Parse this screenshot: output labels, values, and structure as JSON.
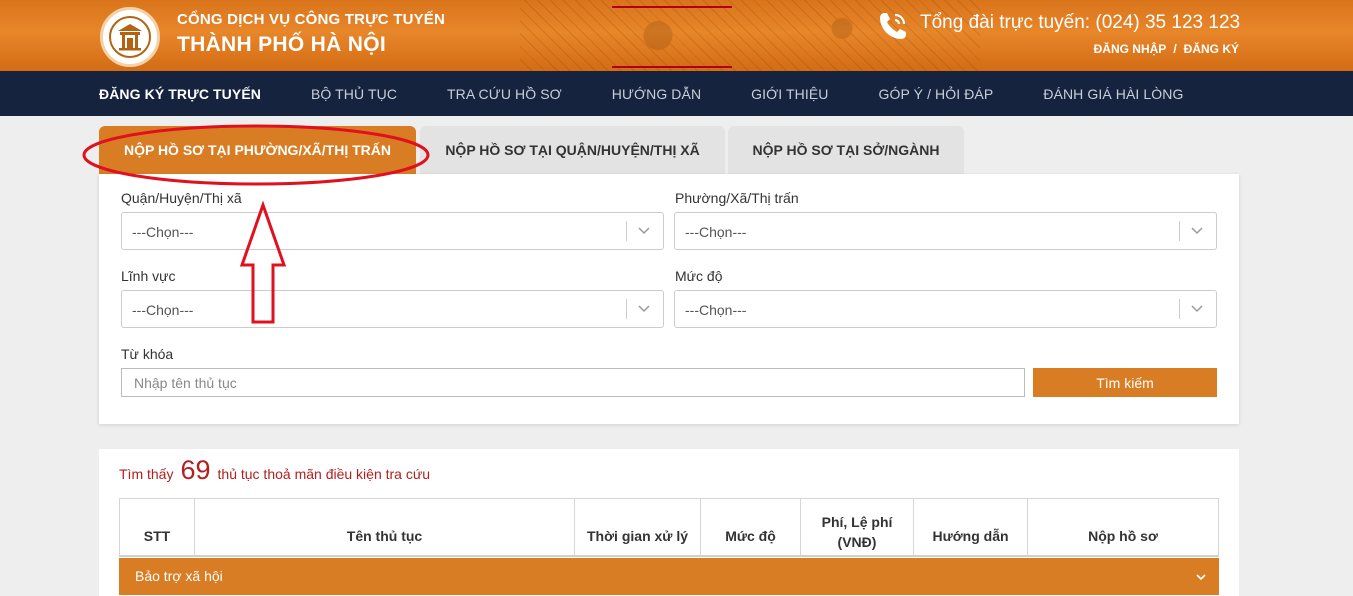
{
  "header": {
    "title_line1": "CỔNG DỊCH VỤ CÔNG TRỰC TUYẾN",
    "title_line2": "THÀNH PHỐ HÀ NỘI",
    "hotline": "Tổng đài trực tuyến: (024) 35 123 123",
    "login": "ĐĂNG NHẬP",
    "separator": "/",
    "register": "ĐĂNG KÝ",
    "logo_icon": "hanoi-emblem-icon",
    "phone_icon": "phone-icon"
  },
  "nav": {
    "items": [
      {
        "label": "ĐĂNG KÝ TRỰC TUYẾN",
        "active": true
      },
      {
        "label": "BỘ THỦ TỤC"
      },
      {
        "label": "TRA CỨU HỒ SƠ"
      },
      {
        "label": "HƯỚNG DẪN"
      },
      {
        "label": "GIỚI THIỆU"
      },
      {
        "label": "GÓP Ý / HỎI ĐÁP"
      },
      {
        "label": "ĐÁNH GIÁ HÀI LÒNG"
      }
    ]
  },
  "tabs": [
    {
      "label": "NỘP HỒ SƠ TẠI PHƯỜNG/XÃ/THỊ TRẤN",
      "active": true
    },
    {
      "label": "NỘP HỒ SƠ TẠI QUẬN/HUYỆN/THỊ XÃ"
    },
    {
      "label": "NỘP HỒ SƠ TẠI SỞ/NGÀNH"
    }
  ],
  "filters": {
    "district": {
      "label": "Quận/Huyện/Thị xã",
      "value": "---Chọn---"
    },
    "ward": {
      "label": "Phường/Xã/Thị trấn",
      "value": "---Chọn---"
    },
    "field": {
      "label": "Lĩnh vực",
      "value": "---Chọn---"
    },
    "level": {
      "label": "Mức độ",
      "value": "---Chọn---"
    },
    "keyword": {
      "label": "Từ khóa",
      "placeholder": "Nhập tên thủ tục"
    },
    "search_label": "Tìm kiếm"
  },
  "results": {
    "prefix": "Tìm thấy",
    "count": "69",
    "suffix": "thủ tục thoả mãn điều kiện tra cứu",
    "columns": [
      "STT",
      "Tên thủ tục",
      "Thời gian xử lý",
      "Mức độ",
      "Phí, Lệ phí (VNĐ)",
      "Hướng dẫn",
      "Nộp hồ sơ"
    ],
    "groups": [
      {
        "label": "Bảo trợ xã hội"
      }
    ]
  },
  "colors": {
    "accent": "#d97d25",
    "nav_bg": "#15233f",
    "annotation": "#e0101e"
  }
}
